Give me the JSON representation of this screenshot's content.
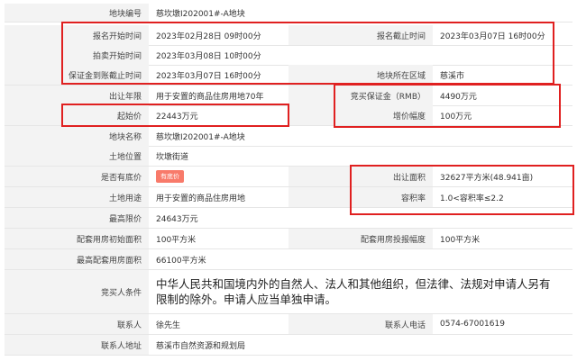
{
  "rows": {
    "r0": {
      "l1": "地块编号",
      "v1": "慈坎墩I202001#-A地块"
    },
    "r1": {
      "l1": "报名开始时间",
      "v1": "2023年02月28日 09时00分",
      "l2": "报名截止时间",
      "v2": "2023年03月07日 16时00分"
    },
    "r2": {
      "l1": "拍卖开始时间",
      "v1": "2023年03月08日 10时00分"
    },
    "r3": {
      "l1": "保证金到账截止时间",
      "v1": "2023年03月07日 16时00分",
      "l2": "地块所在区域",
      "v2": "慈溪市"
    },
    "r4": {
      "l1": "出让年限",
      "v1": "用于安置的商品住房用地70年",
      "l2": "竞买保证金（RMB）",
      "v2": "4490万元"
    },
    "r5": {
      "l1": "起始价",
      "v1": "22443万元",
      "l2": "增价幅度",
      "v2": "100万元"
    },
    "r6": {
      "l1": "地块名称",
      "v1": "慈坎墩I202001#-A地块"
    },
    "r7": {
      "l1": "土地位置",
      "v1": "坎墩街道"
    },
    "r8": {
      "l1": "是否有底价",
      "tag": "有底价",
      "l2": "出让面积",
      "v2": "32627平方米(48.941亩)"
    },
    "r9": {
      "l1": "土地用途",
      "v1": "用于安置的商品住房用地",
      "l2": "容积率",
      "v2": "1.0<容积率≤2.2"
    },
    "r10": {
      "l1": "最高限价",
      "v1": "24643万元"
    },
    "r11": {
      "l1": "配套用房初始面积",
      "v1": "100平方米",
      "l2": "配套用房投报幅度",
      "v2": "100平方米"
    },
    "r12": {
      "l1": "最高配套用房面积",
      "v1": "66100平方米"
    },
    "r13": {
      "l1": "竞买人条件",
      "v1": "中华人民共和国境内外的自然人、法人和其他组织，但法律、法规对申请人另有限制的除外。申请人应当单独申请。"
    },
    "r14": {
      "l1": "联系人",
      "v1": "徐先生",
      "l2": "联系人电话",
      "v2": "0574-67001619"
    },
    "r15": {
      "l1": "联系人地址",
      "v1": "慈溪市自然资源和规划局"
    }
  },
  "colors": {
    "highlight": "#e02020",
    "tag_bg": "#f87a6a",
    "label_bg": "#f3f3f3"
  }
}
